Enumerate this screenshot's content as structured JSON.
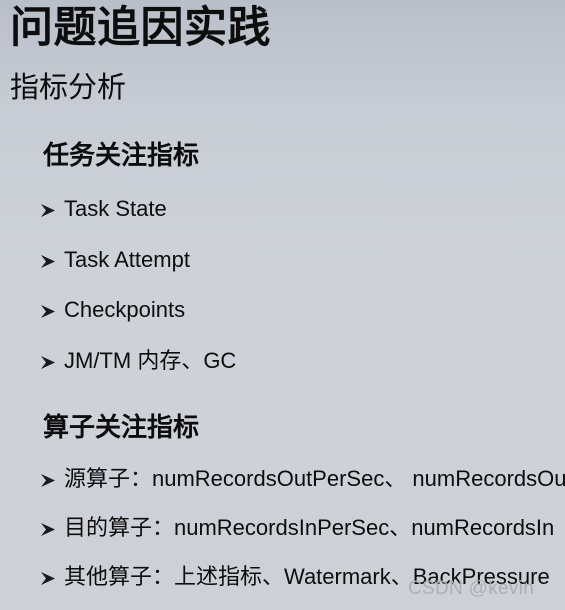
{
  "slide": {
    "title": "问题追因实践",
    "subtitle": "指标分析",
    "background_color": "#ced2d8",
    "text_color": "#0d0d0d"
  },
  "sections": [
    {
      "heading": "任务关注指标",
      "bullet_glyph": "arrow-bullet-icon",
      "items": [
        {
          "text": "Task State"
        },
        {
          "text": "Task Attempt"
        },
        {
          "text": "Checkpoints"
        },
        {
          "text": "JM/TM 内存、GC"
        }
      ]
    },
    {
      "heading": "算子关注指标",
      "bullet_glyph": "arrow-bullet-icon",
      "items": [
        {
          "text": "源算子：numRecordsOutPerSec、 numRecordsOut"
        },
        {
          "text": "目的算子：numRecordsInPerSec、numRecordsIn"
        },
        {
          "text": "其他算子：上述指标、Watermark、BackPressure"
        }
      ]
    }
  ],
  "watermark": {
    "text": "CSDN @kevin",
    "color": "#a9aeb6"
  }
}
